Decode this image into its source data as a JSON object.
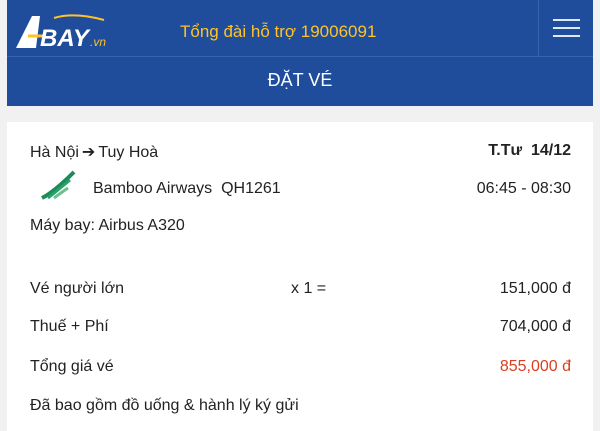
{
  "header": {
    "logo_text": "ABAY.vn",
    "hotline": "Tổng đài hỗ trợ 19006091",
    "menu_icon": "hamburger-icon",
    "title": "ĐẶT VÉ"
  },
  "flight": {
    "origin": "Hà Nội",
    "destination": "Tuy Hoà",
    "day": "T.Tư",
    "date": "14/12",
    "airline": "Bamboo Airways",
    "flight_no": "QH1261",
    "time": "06:45 - 08:30",
    "aircraft": "Máy bay: Airbus A320"
  },
  "price": {
    "adult_label": "Vé người lớn",
    "adult_qty": "x 1 =",
    "adult_amount": "151,000 đ",
    "tax_label": "Thuế + Phí",
    "tax_amount": "704,000 đ",
    "total_label": "Tổng giá vé",
    "total_amount": "855,000 đ",
    "note": "Đã bao gồm đồ uống & hành lý ký gửi"
  },
  "colors": {
    "header_bg": "#1f4d9c",
    "hotline": "#ffc227",
    "total": "#d9401f"
  }
}
